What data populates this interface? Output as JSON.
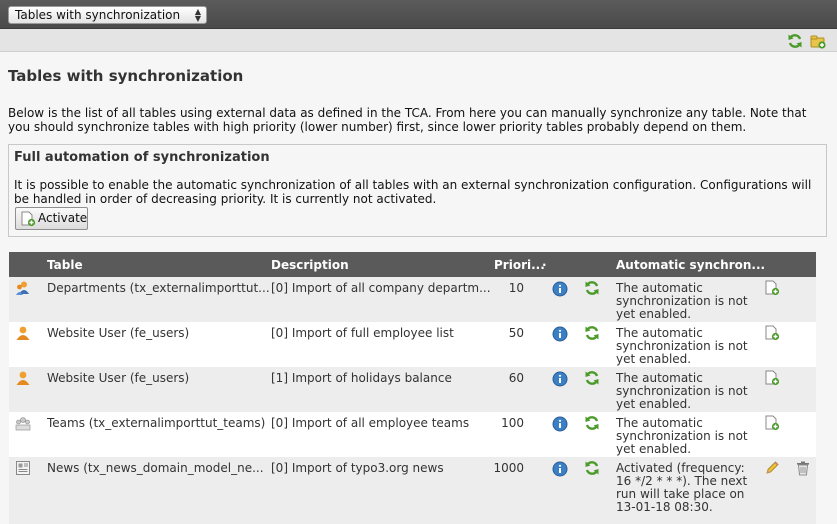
{
  "toolbar": {
    "module_select": "Tables with synchronization"
  },
  "docheader": {
    "icons": [
      "refresh-icon",
      "add-folder-icon"
    ]
  },
  "page": {
    "title": "Tables with synchronization",
    "intro": "Below is the list of all tables using external data as defined in the TCA. From here you can manually synchronize any table. Note that you should synchronize tables with high priority (lower number) first, since lower priority tables probably depend on them."
  },
  "automation": {
    "title": "Full automation of synchronization",
    "text": "It is possible to enable the automatic synchronization of all tables with an external synchronization configuration. Configurations will be handled in order of decreasing priority. It is currently not activated.",
    "button": "Activate"
  },
  "table": {
    "headers": {
      "table": "Table",
      "description": "Description",
      "priority": "Priori...",
      "dot": "·",
      "automatic": "Automatic synchron..."
    },
    "rows": [
      {
        "icon": "department-icon",
        "table": "Departments (tx_externalimporttut...",
        "description": "[0] Import of all company departm...",
        "priority": "10",
        "status": "The automatic synchronization is not yet enabled.",
        "action": "add-task-icon"
      },
      {
        "icon": "user-icon",
        "table": "Website User (fe_users)",
        "description": "[0] Import of full employee list",
        "priority": "50",
        "status": "The automatic synchronization is not yet enabled.",
        "action": "add-task-icon"
      },
      {
        "icon": "user-icon",
        "table": "Website User (fe_users)",
        "description": "[1] Import of holidays balance",
        "priority": "60",
        "status": "The automatic synchronization is not yet enabled.",
        "action": "add-task-icon"
      },
      {
        "icon": "team-icon",
        "table": "Teams (tx_externalimporttut_teams)",
        "description": "[0] Import of all employee teams",
        "priority": "100",
        "status": "The automatic synchronization is not yet enabled.",
        "action": "add-task-icon"
      },
      {
        "icon": "news-icon",
        "table": "News (tx_news_domain_model_ne...",
        "description": "[0] Import of typo3.org news",
        "priority": "1000",
        "status": "Activated (frequency: 16 */2 * * *). The next run will take place on 13-01-18 08:30.",
        "action": "edit-icon"
      }
    ]
  },
  "colors": {
    "topbar": "#4f4f4f",
    "table_header": "#5a5a5a",
    "row_alt": "#ededed",
    "info_blue": "#3b7fc4",
    "sync_green": "#4b9a2a"
  }
}
